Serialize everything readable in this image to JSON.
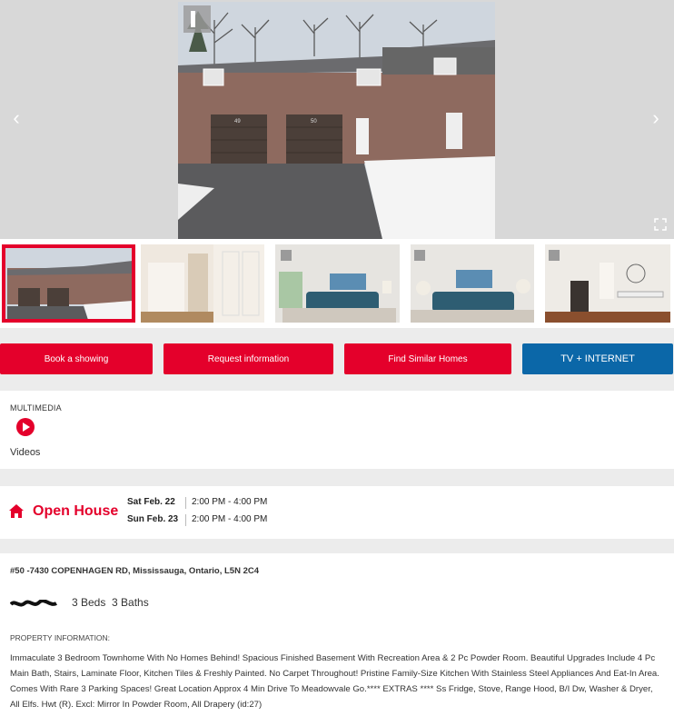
{
  "gallery": {
    "photo_count": 5,
    "active_index": 0,
    "unit_numbers": [
      "49",
      "50"
    ]
  },
  "actions": {
    "book_showing": "Book a showing",
    "request_info": "Request information",
    "similar_homes": "Find Similar Homes",
    "tv_internet": "TV + INTERNET"
  },
  "multimedia": {
    "heading": "MULTIMEDIA",
    "videos_label": "Videos"
  },
  "open_house": {
    "title": "Open House",
    "sessions": [
      {
        "date": "Sat Feb. 22",
        "time": "2:00 PM - 4:00 PM"
      },
      {
        "date": "Sun Feb. 23",
        "time": "2:00 PM - 4:00 PM"
      }
    ]
  },
  "listing": {
    "address": "#50 -7430 COPENHAGEN RD, Mississauga, Ontario, L5N 2C4",
    "beds_baths": "3 Beds  3 Baths",
    "info_heading": "PROPERTY INFORMATION:",
    "description": "Immaculate 3 Bedroom Townhome With No Homes Behind! Spacious Finished Basement With Recreation Area & 2 Pc Powder Room. Beautiful Upgrades Include 4 Pc Main Bath, Stairs, Laminate Floor, Kitchen Tiles & Freshly Painted. No Carpet Throughout! Pristine Family-Size Kitchen With Stainless Steel Appliances And Eat-In Area. Comes With Rare 3 Parking Spaces! Great Location Approx 4 Min Drive To Meadowvale Go.**** EXTRAS **** Ss Fridge, Stove, Range Hood, B/I Dw, Washer & Dryer, All Elfs. Hwt (R). Excl: Mirror In Powder Room, All Drapery (id:27)"
  },
  "colors": {
    "brand_red": "#e4002b",
    "blue": "#0b67a8"
  }
}
